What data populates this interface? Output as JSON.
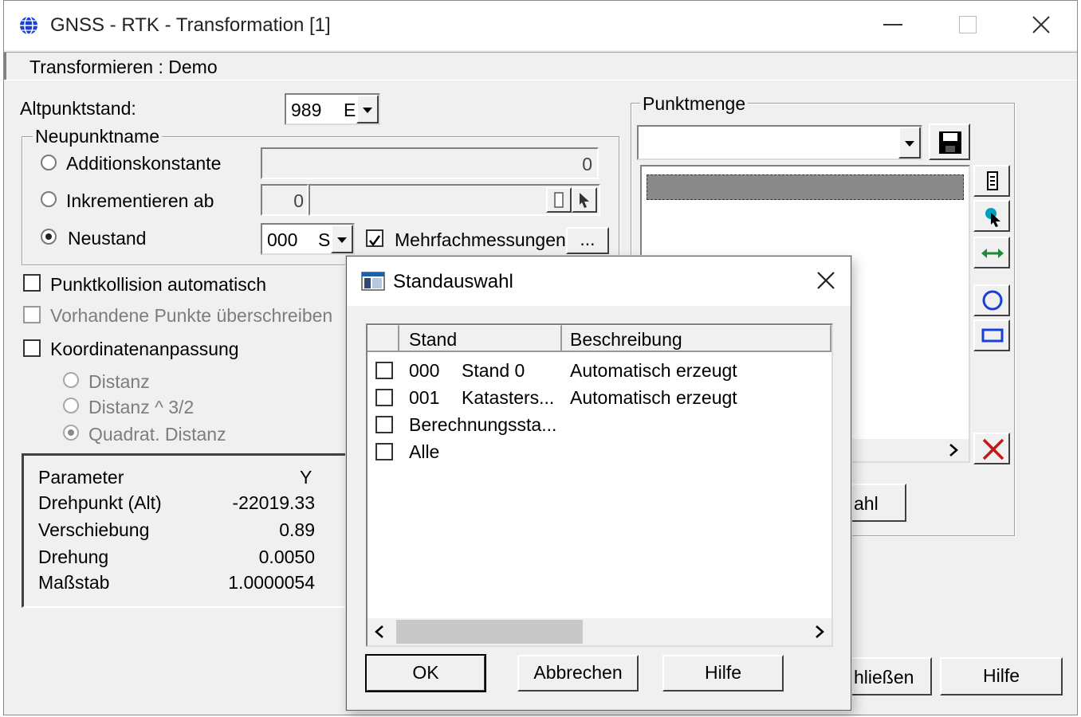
{
  "window": {
    "title": "GNSS - RTK - Transformation [1]",
    "menuband": "Transformieren : Demo"
  },
  "form": {
    "altpunktstand_label": "Altpunktstand:",
    "altpunktstand_value": "989",
    "altpunktstand_trunc": "E",
    "neupunktname_legend": "Neupunktname",
    "opt_additionskonstante": "Additionskonstante",
    "additionskonstante_value": "0",
    "opt_inkrementieren": "Inkrementieren ab",
    "inkrementieren_value": "0",
    "opt_neustand": "Neustand",
    "neustand_value": "000",
    "neustand_trunc": "S",
    "mehrfach_label": "Mehrfachmessungen",
    "mehrfach_button": "...",
    "punktkollision_label": "Punktkollision automatisch",
    "vorhandene_label": "Vorhandene Punkte überschreiben",
    "koordinaten_label": "Koordinatenanpassung",
    "opt_distanz": "Distanz",
    "opt_distanz32": "Distanz ^ 3/2",
    "opt_quadrat": "Quadrat. Distanz"
  },
  "params": {
    "header_param": "Parameter",
    "header_y": "Y",
    "rows": [
      {
        "name": "Drehpunkt (Alt)",
        "y": "-22019.33"
      },
      {
        "name": "Verschiebung",
        "y": "0.89"
      },
      {
        "name": "Drehung",
        "y": "0.0050"
      },
      {
        "name": "Maßstab",
        "y": "1.0000054"
      }
    ]
  },
  "punktmenge": {
    "legend": "Punktmenge",
    "select_value": "",
    "auswahl_button_partial": "ahl"
  },
  "footer": {
    "schliessen_partial": "hließen",
    "hilfe": "Hilfe"
  },
  "dialog": {
    "title": "Standauswahl",
    "col_stand": "Stand",
    "col_beschreibung": "Beschreibung",
    "rows": [
      {
        "code": "000",
        "name": "Stand 0",
        "desc": "Automatisch erzeugt"
      },
      {
        "code": "001",
        "name": "Katasters...",
        "desc": "Automatisch erzeugt"
      },
      {
        "code": "Berechnungssta...",
        "name": "",
        "desc": ""
      },
      {
        "code": "Alle",
        "name": "",
        "desc": ""
      }
    ],
    "ok": "OK",
    "abbrechen": "Abbrechen",
    "hilfe": "Hilfe"
  },
  "colors": {
    "accent_blue": "#1a3fd6",
    "cyan_icon": "#00a0c0",
    "green_icon": "#1e8a3a",
    "red_x": "#c01818"
  }
}
